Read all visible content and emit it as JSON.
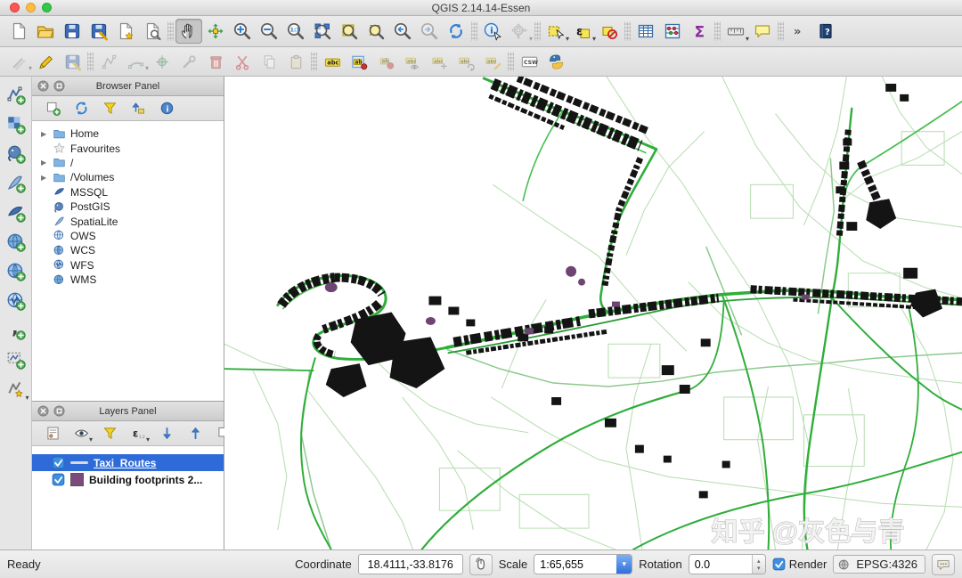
{
  "window": {
    "title": "QGIS 2.14.14-Essen"
  },
  "toolbars": {
    "main": [
      {
        "name": "new-project"
      },
      {
        "name": "open-project"
      },
      {
        "name": "save-project"
      },
      {
        "name": "save-project-as"
      },
      {
        "name": "new-composer"
      },
      {
        "name": "composer-manager"
      },
      {
        "sep": true
      },
      {
        "name": "pan-map",
        "active": true
      },
      {
        "name": "pan-to-selection"
      },
      {
        "name": "zoom-in"
      },
      {
        "name": "zoom-out"
      },
      {
        "name": "zoom-native"
      },
      {
        "name": "zoom-full"
      },
      {
        "name": "zoom-to-layer"
      },
      {
        "name": "zoom-to-selection"
      },
      {
        "name": "zoom-last"
      },
      {
        "name": "zoom-next",
        "disabled": true
      },
      {
        "name": "map-refresh"
      },
      {
        "sep": true
      },
      {
        "name": "identify-features"
      },
      {
        "name": "feature-action",
        "disabled": true,
        "dropdown": true
      },
      {
        "sep": true
      },
      {
        "name": "select-rectangle",
        "dropdown": true
      },
      {
        "name": "select-expression",
        "dropdown": true
      },
      {
        "name": "deselect-all"
      },
      {
        "sep": true
      },
      {
        "name": "attribute-table"
      },
      {
        "name": "statistics-panel"
      },
      {
        "name": "field-calculator"
      },
      {
        "sep": true
      },
      {
        "name": "measure",
        "dropdown": true
      },
      {
        "name": "map-tips"
      },
      {
        "sep": true
      },
      {
        "name": "toolbar-overflow"
      },
      {
        "name": "help-contents"
      }
    ],
    "edit": [
      {
        "name": "current-edits",
        "disabled": true,
        "dropdown": true
      },
      {
        "name": "toggle-editing"
      },
      {
        "name": "save-edits",
        "disabled": true
      },
      {
        "sep": true
      },
      {
        "name": "add-feature",
        "disabled": true
      },
      {
        "name": "circular-string",
        "disabled": true,
        "dropdown": true
      },
      {
        "name": "move-feature",
        "disabled": true
      },
      {
        "name": "node-tool",
        "disabled": true
      },
      {
        "name": "delete-selected",
        "disabled": true
      },
      {
        "name": "cut-features",
        "disabled": true
      },
      {
        "name": "copy-features",
        "disabled": true
      },
      {
        "name": "paste-features",
        "disabled": true
      },
      {
        "sep": true
      },
      {
        "name": "labeling"
      },
      {
        "name": "pin-labels"
      },
      {
        "name": "highlight-pinned",
        "disabled": true
      },
      {
        "name": "show-hide-labels",
        "disabled": true
      },
      {
        "name": "move-label",
        "disabled": true
      },
      {
        "name": "rotate-label",
        "disabled": true
      },
      {
        "name": "change-label",
        "disabled": true
      },
      {
        "sep": true
      },
      {
        "name": "metasearch"
      },
      {
        "name": "python-console"
      }
    ],
    "left": [
      {
        "name": "add-vector-layer"
      },
      {
        "name": "add-raster-layer"
      },
      {
        "name": "add-postgis-layer"
      },
      {
        "name": "add-spatialite-layer"
      },
      {
        "name": "add-mssql-layer"
      },
      {
        "name": "add-wms-layer"
      },
      {
        "name": "add-wcs-layer"
      },
      {
        "name": "add-wfs-layer"
      },
      {
        "name": "add-delimited-text"
      },
      {
        "name": "add-virtual-layer"
      },
      {
        "name": "new-shapefile-layer",
        "dropdown": true
      }
    ],
    "browser": [
      {
        "name": "add-selected-layers"
      },
      {
        "name": "refresh-browser"
      },
      {
        "name": "filter-browser"
      },
      {
        "name": "collapse-browser"
      },
      {
        "name": "browser-properties"
      }
    ],
    "layers": [
      {
        "name": "styling-dock"
      },
      {
        "name": "manage-visibility",
        "dropdown": true
      },
      {
        "name": "filter-legend"
      },
      {
        "name": "filter-expression",
        "dropdown": true
      },
      {
        "name": "expand-all"
      },
      {
        "name": "collapse-all"
      },
      {
        "name": "remove-layer"
      }
    ]
  },
  "browser_panel": {
    "title": "Browser Panel",
    "items": [
      {
        "label": "Home",
        "icon": "folder",
        "expandable": true
      },
      {
        "label": "Favourites",
        "icon": "star",
        "expandable": false
      },
      {
        "label": "/",
        "icon": "folder",
        "expandable": true
      },
      {
        "label": "/Volumes",
        "icon": "folder",
        "expandable": true
      },
      {
        "label": "MSSQL",
        "icon": "db-mssql",
        "expandable": false
      },
      {
        "label": "PostGIS",
        "icon": "db-postgis",
        "expandable": false
      },
      {
        "label": "SpatiaLite",
        "icon": "db-spatialite",
        "expandable": false
      },
      {
        "label": "OWS",
        "icon": "globe-ows",
        "expandable": false
      },
      {
        "label": "WCS",
        "icon": "globe-wcs",
        "expandable": false
      },
      {
        "label": "WFS",
        "icon": "globe-wfs",
        "expandable": false
      },
      {
        "label": "WMS",
        "icon": "globe-wms",
        "expandable": false
      }
    ]
  },
  "layers_panel": {
    "title": "Layers Panel",
    "layers": [
      {
        "label": "Taxi_Routes",
        "checked": true,
        "selected": true,
        "symbol": "line",
        "color": "#d9d9d9"
      },
      {
        "label": "Building footprints 2...",
        "checked": true,
        "selected": false,
        "symbol": "fill",
        "color": "#7d4a7d"
      }
    ]
  },
  "status_bar": {
    "ready": "Ready",
    "coordinate_label": "Coordinate",
    "coordinate_value": "18.4111,-33.8176",
    "scale_label": "Scale",
    "scale_value": "1:65,655",
    "rotation_label": "Rotation",
    "rotation_value": "0.0",
    "render_label": "Render",
    "crs_value": "EPSG:4326"
  },
  "map": {
    "watermark": "知乎 @灰色与青",
    "route_color": "#2fae3a",
    "building_color": "#141414"
  }
}
